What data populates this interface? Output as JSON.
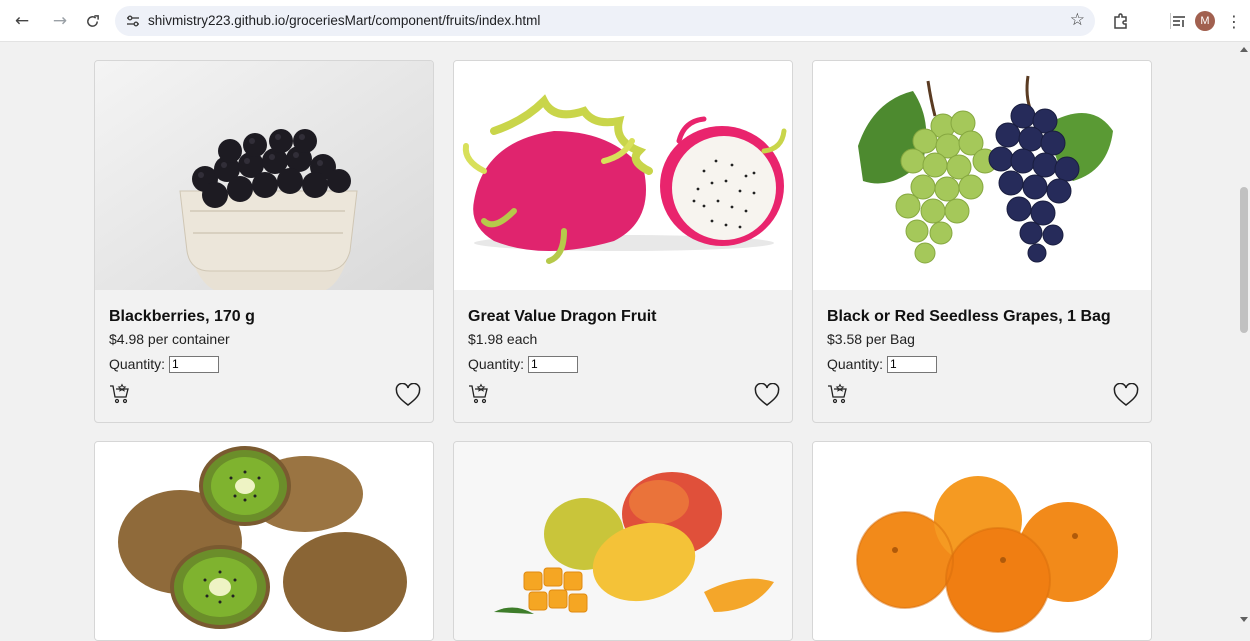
{
  "browser": {
    "url": "shivmistry223.github.io/groceriesMart/component/fruits/index.html",
    "avatar_letter": "M",
    "icons": [
      "back-arrow-icon",
      "forward-arrow-icon",
      "reload-icon",
      "site-info-icon",
      "bookmark-star-icon",
      "extensions-icon",
      "reading-list-icon",
      "kebab-menu-icon"
    ]
  },
  "products": [
    {
      "title": "Blackberries, 170 g",
      "price": "$4.98 per container",
      "quantity_label": "Quantity:",
      "quantity": "1",
      "image": "blackberries"
    },
    {
      "title": "Great Value Dragon Fruit",
      "price": "$1.98 each",
      "quantity_label": "Quantity:",
      "quantity": "1",
      "image": "dragon-fruit"
    },
    {
      "title": "Black or Red Seedless Grapes, 1 Bag",
      "price": "$3.58 per Bag",
      "quantity_label": "Quantity:",
      "quantity": "1",
      "image": "grapes"
    },
    {
      "image": "kiwi"
    },
    {
      "image": "mango"
    },
    {
      "image": "oranges"
    }
  ],
  "colors": {
    "page_bg": "#f1f1f1",
    "card_bg": "#f2f2f2",
    "omnibox_bg": "#eef1f8",
    "avatar_bg": "#a1604f"
  }
}
